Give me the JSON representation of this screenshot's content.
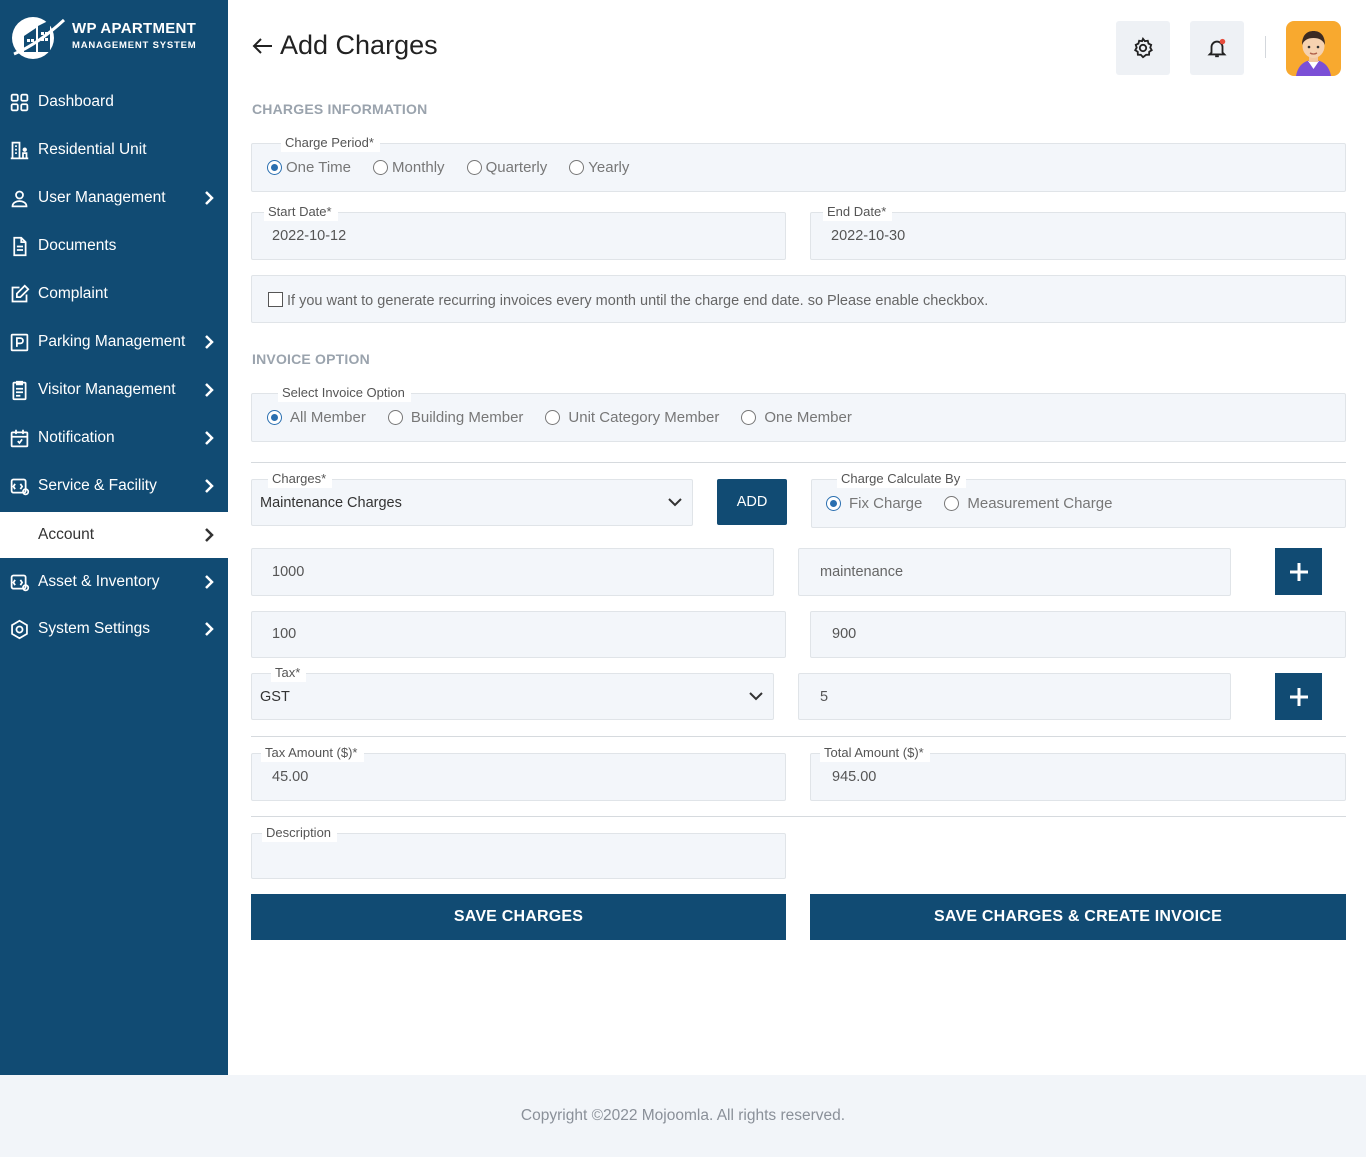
{
  "logo": {
    "title": "WP APARTMENT",
    "subtitle": "MANAGEMENT SYSTEM"
  },
  "sidebar": {
    "items": [
      {
        "label": "Dashboard",
        "icon": "grid-icon",
        "has_submenu": false
      },
      {
        "label": "Residential Unit",
        "icon": "building-icon",
        "has_submenu": false
      },
      {
        "label": "User Management",
        "icon": "user-icon",
        "has_submenu": true
      },
      {
        "label": "Documents",
        "icon": "document-icon",
        "has_submenu": false
      },
      {
        "label": "Complaint",
        "icon": "edit-icon",
        "has_submenu": false
      },
      {
        "label": "Parking Management",
        "icon": "parking-icon",
        "has_submenu": true
      },
      {
        "label": "Visitor Management",
        "icon": "clipboard-icon",
        "has_submenu": true
      },
      {
        "label": "Notification",
        "icon": "calendar-icon",
        "has_submenu": true
      },
      {
        "label": "Service & Facility",
        "icon": "service-icon",
        "has_submenu": true
      },
      {
        "label": "Account",
        "icon": "account-icon",
        "has_submenu": true,
        "active": true
      },
      {
        "label": "Asset & Inventory",
        "icon": "inventory-icon",
        "has_submenu": true
      },
      {
        "label": "System Settings",
        "icon": "settings-icon",
        "has_submenu": true
      }
    ]
  },
  "header": {
    "title": "Add Charges"
  },
  "sections": {
    "charges_info": "CHARGES INFORMATION",
    "invoice_option": "INVOICE OPTION"
  },
  "charge_period": {
    "label": "Charge Period*",
    "options": [
      "One Time",
      "Monthly",
      "Quarterly",
      "Yearly"
    ],
    "selected": "One Time"
  },
  "start_date": {
    "label": "Start Date*",
    "value": "2022-10-12"
  },
  "end_date": {
    "label": "End Date*",
    "value": "2022-10-30"
  },
  "recurring": {
    "text": "If you want to generate recurring invoices every month until the charge end date. so Please enable checkbox.",
    "checked": false
  },
  "invoice_option": {
    "label": "Select Invoice Option",
    "options": [
      "All Member",
      "Building Member",
      "Unit Category Member",
      "One Member"
    ],
    "selected": "All Member"
  },
  "charges": {
    "label": "Charges*",
    "value": "Maintenance Charges",
    "add_label": "ADD"
  },
  "charge_calc": {
    "label": "Charge Calculate By",
    "options": [
      "Fix Charge",
      "Measurement Charge"
    ],
    "selected": "Fix Charge"
  },
  "amount_row": {
    "amount": "1000",
    "description": "maintenance"
  },
  "discount_row": {
    "discount": "100",
    "net": "900"
  },
  "tax": {
    "label": "Tax*",
    "value": "GST",
    "rate": "5"
  },
  "tax_amount": {
    "label": "Tax Amount ($)*",
    "value": "45.00"
  },
  "total_amount": {
    "label": "Total Amount ($)*",
    "value": "945.00"
  },
  "description": {
    "label": "Description",
    "value": ""
  },
  "buttons": {
    "save": "SAVE CHARGES",
    "save_invoice": "SAVE CHARGES & CREATE INVOICE"
  },
  "footer": {
    "text": "Copyright ©2022 Mojoomla. All rights reserved."
  },
  "colors": {
    "primary": "#114b73",
    "accent": "#2a6fb0",
    "field_bg": "#f3f6fa"
  }
}
